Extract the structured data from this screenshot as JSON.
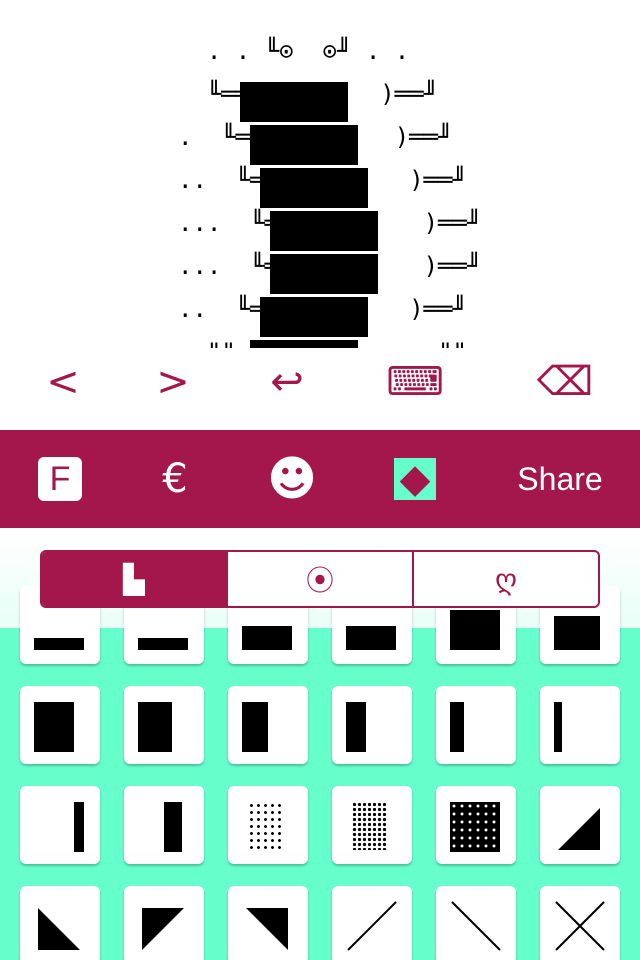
{
  "art": {
    "lines": [
      "  . . ╙⊙  ⊙╜ . .",
      "  ╙══(        )══╜",
      ".  ╙══(        )══╜",
      "..  ╙══(        )══╜",
      "...  ╙══(        )══╜",
      "...  ╙══(        )══╜",
      "..  ╙══(        )══╜",
      "  \"\"              \"\""
    ]
  },
  "edit_bar": {
    "prev": "<",
    "next": ">",
    "return": "↩",
    "keyboard": "⌨",
    "delete": "⌫"
  },
  "toolbar": {
    "font_icon": "F",
    "script_icon": "€",
    "emoji_icon": "☻",
    "shape_icon": "◆",
    "share": "Share"
  },
  "segments": [
    {
      "label": "▙",
      "selected": true
    },
    {
      "label": "⦿",
      "selected": false
    },
    {
      "label": "ღ",
      "selected": false
    }
  ],
  "colors": {
    "accent": "#a3174b",
    "palette_bg": "#66ffcc",
    "tile": "#ffffff"
  }
}
